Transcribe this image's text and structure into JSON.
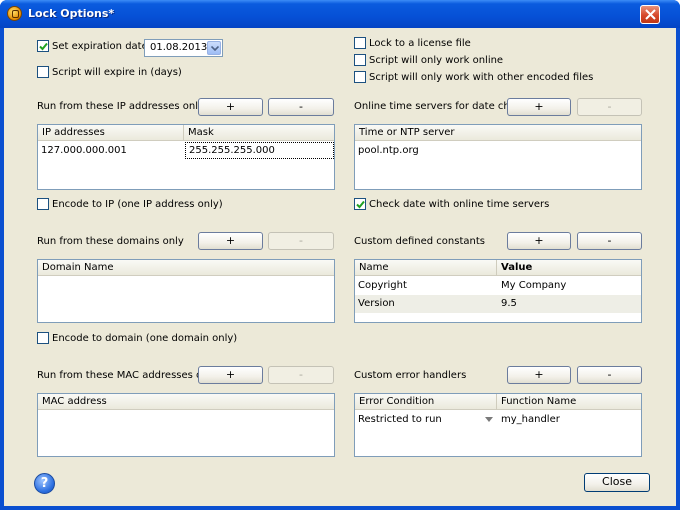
{
  "window": {
    "title": "Lock Options*"
  },
  "expiration": {
    "set_label": "Set expiration date",
    "set_checked": true,
    "date_value": "01.08.2013",
    "script_expire_label": "Script will expire in (days)",
    "script_expire_checked": false
  },
  "right_options": [
    {
      "label": "Lock to a license file",
      "checked": false
    },
    {
      "label": "Script will only work online",
      "checked": false
    },
    {
      "label": "Script will only work with other encoded files",
      "checked": false
    }
  ],
  "ip": {
    "section_label": "Run from these IP addresses only",
    "add": "+",
    "remove": "-",
    "columns": [
      "IP addresses",
      "Mask"
    ],
    "rows": [
      {
        "ip": "127.000.000.001",
        "mask": "255.255.255.000"
      }
    ],
    "encode_label": "Encode to IP (one IP address only)",
    "encode_checked": false
  },
  "time_servers": {
    "section_label": "Online time servers for date check",
    "add": "+",
    "remove": "-",
    "column": "Time or NTP server",
    "rows": [
      "pool.ntp.org"
    ],
    "check_label": "Check date with online time servers",
    "check_checked": true
  },
  "domains": {
    "section_label": "Run from these domains only",
    "add": "+",
    "remove": "-",
    "column": "Domain Name",
    "encode_label": "Encode to domain (one domain only)",
    "encode_checked": false
  },
  "constants": {
    "section_label": "Custom defined constants",
    "add": "+",
    "remove": "-",
    "columns": [
      "Name",
      "Value"
    ],
    "rows": [
      {
        "name": "Copyright",
        "value": "My Company"
      },
      {
        "name": "Version",
        "value": "9.5"
      }
    ]
  },
  "mac": {
    "section_label": "Run from these MAC addresses only",
    "add": "+",
    "remove": "-",
    "column": "MAC address"
  },
  "error_handlers": {
    "section_label": "Custom error handlers",
    "add": "+",
    "remove": "-",
    "columns": [
      "Error Condition",
      "Function Name"
    ],
    "rows": [
      {
        "condition": "Restricted to run",
        "function": "my_handler"
      }
    ]
  },
  "footer": {
    "help": "?",
    "close": "Close"
  }
}
